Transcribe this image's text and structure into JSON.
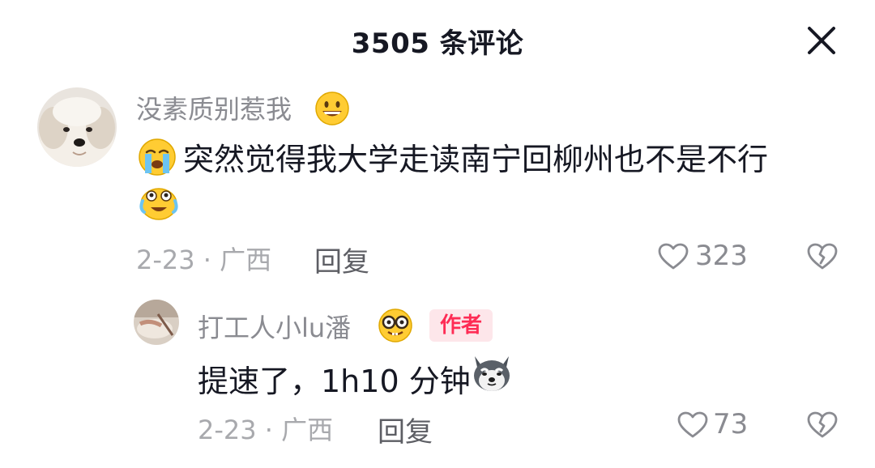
{
  "header": {
    "title": "3505 条评论"
  },
  "comments": [
    {
      "username": "没素质别惹我",
      "text": "突然觉得我大学走读南宁回柳州也不是不行",
      "date_location": "2-23 · 广西",
      "reply_label": "回复",
      "likes": "323"
    },
    {
      "username": "打工人小lu潘",
      "badge": "作者",
      "text": "提速了，1h10 分钟",
      "date_location": "2-23 · 广西",
      "reply_label": "回复",
      "likes": "73"
    }
  ],
  "icons": {
    "close": "close-icon",
    "like": "heart-icon",
    "dislike": "broken-heart-icon"
  },
  "colors": {
    "badge_text": "#fe2c55",
    "badge_bg": "#fde6ea",
    "muted_text": "#8a8b91"
  }
}
